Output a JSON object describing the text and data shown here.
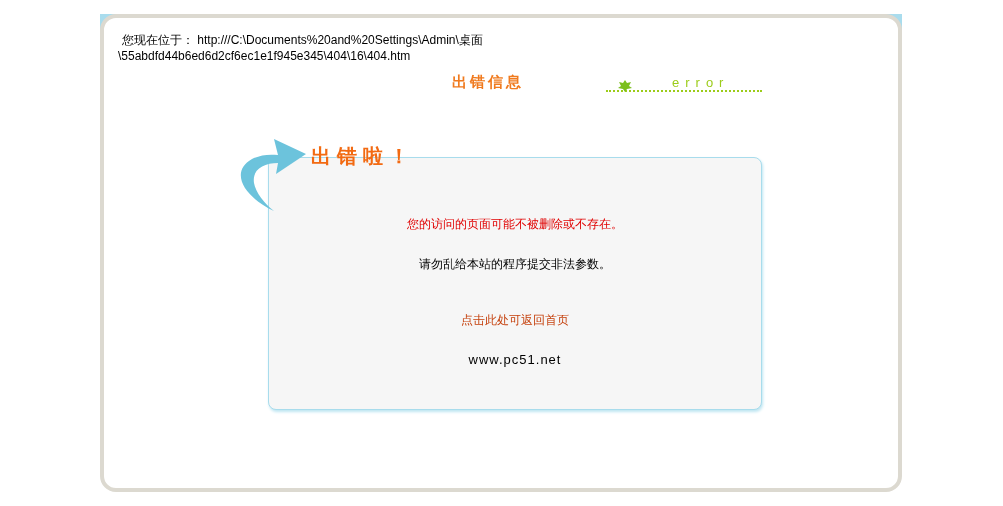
{
  "location": {
    "lines": [
      "您现在位于： http:///C:\\Documents%20and%20Settings\\Admin\\桌面",
      "\\55abdfd44b6ed6d2cf6ec1e1f945e345\\404\\16\\404.htm"
    ]
  },
  "header": {
    "title": "出错信息",
    "badge": "error"
  },
  "card": {
    "title": "出错啦！",
    "messages": [
      {
        "kind": "warning",
        "text": "您的访问的页面可能不被删除或不存在。"
      },
      {
        "kind": "note",
        "text": "请勿乱给本站的程序提交非法参数。"
      },
      {
        "kind": "link",
        "text": "点击此处可返回首页"
      },
      {
        "kind": "site",
        "text": "www.pc51.net"
      }
    ]
  }
}
